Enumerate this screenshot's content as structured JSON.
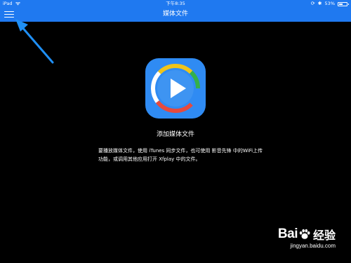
{
  "status_bar": {
    "device": "iPad",
    "time": "下午8:35",
    "battery_percent": "53%",
    "battery_level": 0.53
  },
  "nav": {
    "title": "媒体文件",
    "menu_icon": "hamburger-menu-icon"
  },
  "empty_state": {
    "app_icon": "xfplay-play-icon",
    "title": "添加媒体文件",
    "description": "要播放媒体文件，使用 iTunes 同步文件，也可使用 影音先锋 中的WiFi上传功能，或调用其他应用打开 Xfplay 中的文件。"
  },
  "colors": {
    "nav_blue": "#1f79f0",
    "background": "#000000",
    "annotation_arrow": "#1f8ff5"
  },
  "watermark": {
    "logo_text_left": "Bai",
    "logo_text_right": "经验",
    "url": "jingyan.baidu.com"
  }
}
